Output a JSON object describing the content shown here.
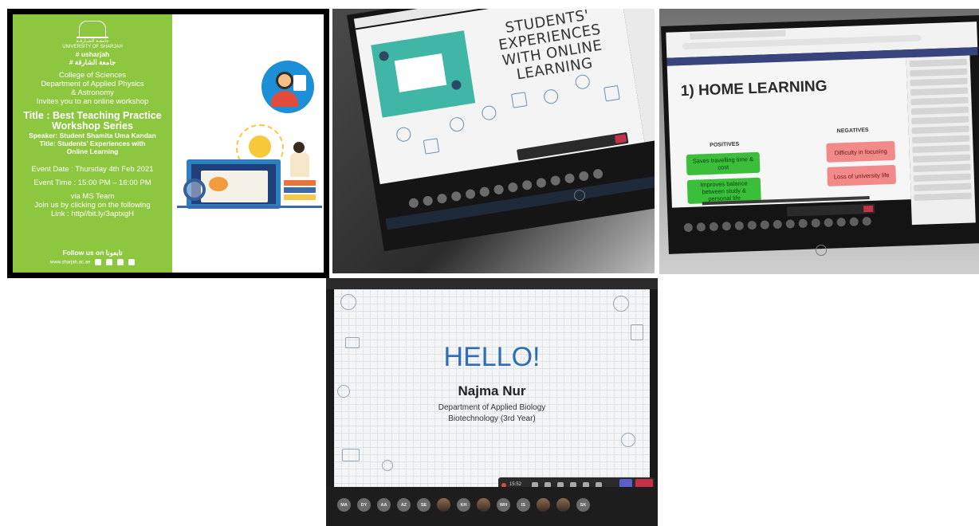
{
  "poster": {
    "uni_arabic": "جامعـة الشـارقـة",
    "uni_name": "UNIVERSITY OF SHARJAH",
    "hashtag_en": "# usharjah",
    "hashtag_ar": "# جامعة الشارقة",
    "college": "College of Sciences",
    "department": "Department of Applied Physics",
    "department2": "& Astronomy",
    "invite": "Invites you to an online workshop",
    "title_line1": "Title : Best Teaching Practice",
    "title_line2": "Workshop Series",
    "speaker": "Speaker: Student Shamita Uma Kandan",
    "talk_title1": "Title: Students' Experiences with",
    "talk_title2": "Online Learning",
    "event_date": "Event Date : Thursday 4th Feb 2021",
    "event_time": "Event Time : 15:00 PM – 16:00 PM",
    "via": "via MS Team",
    "join": "Join us by clicking on the following",
    "link": "Link : http//bit.ly/3aptxgH",
    "follow": "Follow us on تابعونا",
    "website": "www.sharjah.ac.ae",
    "colors": {
      "green": "#8dc63f"
    }
  },
  "panel2": {
    "slide_title": "STUDENTS' EXPERIENCES WITH ONLINE LEARNING",
    "brand": "hp"
  },
  "panel3": {
    "slide_title": "1) HOME LEARNING",
    "positives_header": "POSITIVES",
    "negatives_header": "NEGATIVES",
    "positives": [
      "Saves travelling time & cost",
      "Improves balance between study & personal life"
    ],
    "negatives": [
      "Difficulty in focusing",
      "Loss of university life"
    ],
    "brand": "hp"
  },
  "panel4": {
    "greeting": "HELLO!",
    "name": "Najma Nur",
    "department": "Department of Applied Biology",
    "program": "Biotechnology (3rd Year)",
    "timer": "15:52",
    "avatars": [
      "MA",
      "DY",
      "AA",
      "AZ",
      "SE",
      "",
      "KH",
      "",
      "WH",
      "IS",
      "",
      "",
      "SK"
    ]
  }
}
